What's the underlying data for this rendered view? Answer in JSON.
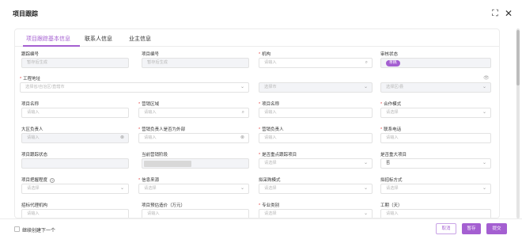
{
  "window": {
    "title": "项目跟踪"
  },
  "tabs": [
    "项目跟踪基本信息",
    "联系人信息",
    "业主信息"
  ],
  "fields": {
    "tracking_no": {
      "label": "跟踪编号",
      "placeholder": "暂存后生成"
    },
    "project_no": {
      "label": "项目编号",
      "placeholder": "暂存后生成"
    },
    "org": {
      "label": "机构",
      "placeholder": "请输入"
    },
    "approval_status": {
      "label": "审核状态",
      "value": "草稿"
    },
    "address": {
      "label": "工程地址",
      "placeholder_country": "选择省/自治区/直辖市",
      "placeholder_city": "选择市",
      "placeholder_district": "选择区/县"
    },
    "project_name": {
      "label": "项目名称",
      "placeholder": "请输入"
    },
    "sales_area": {
      "label": "营销区域",
      "placeholder": "请输入"
    },
    "project_name2": {
      "label": "项目名称",
      "placeholder": "请输入"
    },
    "coop_mode": {
      "label": "合作模式",
      "placeholder": "请选择"
    },
    "region_head": {
      "label": "大区负责人",
      "placeholder": "请输入"
    },
    "sales_owner_external": {
      "label": "营销负责人是否为外部",
      "placeholder": "请输入"
    },
    "sales_owner": {
      "label": "营销负责人",
      "placeholder": "请输入"
    },
    "phone": {
      "label": "联系电话",
      "placeholder": "请输入"
    },
    "tracking_status": {
      "label": "项目跟踪状态",
      "value": ""
    },
    "current_stage": {
      "label": "当前营销阶段",
      "value": ""
    },
    "key_tracking": {
      "label": "是否重点跟踪项目",
      "placeholder": "请选择"
    },
    "major_project": {
      "label": "是否重大项目",
      "value": "否"
    },
    "difficulty": {
      "label": "项目把握程度",
      "placeholder": "请选择"
    },
    "info_source": {
      "label": "信息来源",
      "placeholder": "请选择"
    },
    "purchase_mode": {
      "label": "拟采购模式",
      "placeholder": "请选择"
    },
    "bid_mode": {
      "label": "拟招标方式",
      "placeholder": "请选择"
    },
    "bid_agent": {
      "label": "招标代理机构",
      "placeholder": "请输入"
    },
    "estimated_price": {
      "label": "项目预估造价（万元）",
      "placeholder": "请输入"
    },
    "category": {
      "label": "专业类别",
      "placeholder": "请选择"
    },
    "duration": {
      "label": "工期（天）",
      "placeholder": "请输入"
    }
  },
  "footer": {
    "continue_label": "继续创建下一个",
    "cancel_label": "取消",
    "save_label": "暂存",
    "submit_label": "提交"
  },
  "colors": {
    "accent": "#a45fd1",
    "required": "#e54545"
  }
}
